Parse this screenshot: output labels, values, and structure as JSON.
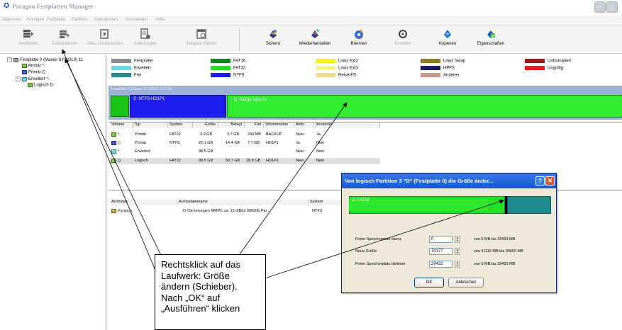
{
  "window": {
    "title": "Paragon Festplatten Manager"
  },
  "menubar": {
    "items": [
      "Allgemein",
      "Anzeigen",
      "Festplatte",
      "Partition",
      "Operationen",
      "Assistenten",
      "Hilfe"
    ]
  },
  "toolbar": {
    "buttons": [
      {
        "label": "Ausführen",
        "icon": "run-icon",
        "enabled": false
      },
      {
        "label": "Zurücksetzen",
        "icon": "undo-icon",
        "enabled": false
      },
      {
        "label": "Alles zurücksetzen",
        "icon": "undo-all-icon",
        "enabled": false
      },
      {
        "label": "Änderungen",
        "icon": "changes-icon",
        "enabled": false
      },
      {
        "label": "Aufgabe Planen",
        "icon": "schedule-icon",
        "enabled": false
      },
      {
        "label": "Sichern",
        "icon": "backup-icon",
        "enabled": true
      },
      {
        "label": "Wiederherstellen",
        "icon": "restore-icon",
        "enabled": true
      },
      {
        "label": "Brennen",
        "icon": "burn-icon",
        "enabled": true
      },
      {
        "label": "Erstellen",
        "icon": "create-icon",
        "enabled": false
      },
      {
        "label": "Kopieren",
        "icon": "copy-icon",
        "enabled": true
      },
      {
        "label": "Eigenschaften",
        "icon": "properties-icon",
        "enabled": true
      }
    ]
  },
  "tree": {
    "disk": "Festplatte 0 (Maxtor 6Y120L0) 11",
    "items": [
      "Primär *:",
      "Primär C:",
      "Erweitert *:",
      "Logisch D:"
    ]
  },
  "legend": [
    {
      "label": "Festplatte",
      "color": "#8c8c8c"
    },
    {
      "label": "Erweitert",
      "color": "#66d9e8"
    },
    {
      "label": "Frei",
      "color": "#1f8b8b"
    },
    {
      "label": "FAT16",
      "color": "#0a8a1a"
    },
    {
      "label": "FAT32",
      "color": "#22e022"
    },
    {
      "label": "NTFS",
      "color": "#1d1df0"
    },
    {
      "label": "Linux Ext2",
      "color": "#f2f21a"
    },
    {
      "label": "Linux Ext3",
      "color": "#f5f58a"
    },
    {
      "label": "ReiserFS",
      "color": "#f0d890"
    },
    {
      "label": "Linux Swap",
      "color": "#8a7a1a"
    },
    {
      "label": "HPFS",
      "color": "#1a1a60"
    },
    {
      "label": "Anderes",
      "color": "#c89a8a"
    },
    {
      "label": "Unformatiert",
      "color": "#9a1a1a"
    },
    {
      "label": "Ungültig",
      "color": "#ee1a1a"
    }
  ],
  "diskmap": {
    "header": "Festplatte 0 (Maxtor 6Y120L0) 114 GB",
    "partition_c": "C: NTFS HD1P1",
    "partition_d": "D: FAT32 HD1P2"
  },
  "partition_table": {
    "headers": [
      "Volume",
      "Typ",
      "System",
      "Größe",
      "Belegt",
      "Frei",
      "Volumename",
      "Aktiv",
      "Versteckt"
    ],
    "rows": [
      [
        "*:",
        "Primär",
        "FAT32",
        "3.9 GB",
        "3.7 GB",
        "240 MB",
        "BACKUP",
        "Nein",
        "Ja"
      ],
      [
        "C:",
        "Primär",
        "NTFS",
        "22.1 GB",
        "14.4 GB",
        "7.7 GB",
        "HD1P1",
        "Ja",
        "Nein"
      ],
      [
        "*:",
        "Erweitert",
        "",
        "88.5 GB",
        "",
        "",
        "",
        "Nein",
        "Nein"
      ],
      [
        "D:",
        "Logisch",
        "FAT32",
        "88.5 GB",
        "59.7 GB",
        "28.8 GB",
        "HD1P2",
        "Nein",
        "Nein"
      ]
    ]
  },
  "archive_table": {
    "headers": [
      "Archivtyp",
      "Archivdateiname",
      "System"
    ],
    "rows": [
      [
        "Partition",
        "D:/Sicherungen MMPC ca. 15 GB/pt 090206 Par...",
        "NTFS"
      ]
    ]
  },
  "dialog": {
    "title": "Von logisch Partition 3 \"D\" (Festplatte 0) die Größe änder...",
    "bar_label": "D: FAT32",
    "fields": [
      {
        "label": "Freier Speicherplatz davor",
        "value": "0",
        "range": "von 0 MB  bis 29493 MB"
      },
      {
        "label": "Neue Größe",
        "value": "70177",
        "range": "von 61116 MB  bis 90609 MB"
      },
      {
        "label": "Freier Speicherplatz dahinter",
        "value": "20432",
        "range": "von 0 MB  bis 29493 MB"
      }
    ],
    "ok_label": "OK",
    "cancel_label": "Abbrechen"
  },
  "callout": {
    "lines": [
      "Rechtsklick auf das",
      "Laufwerk: Größe",
      "ändern (Schieber).",
      "Nach „OK“ auf",
      "„Ausführen“ klicken"
    ]
  }
}
